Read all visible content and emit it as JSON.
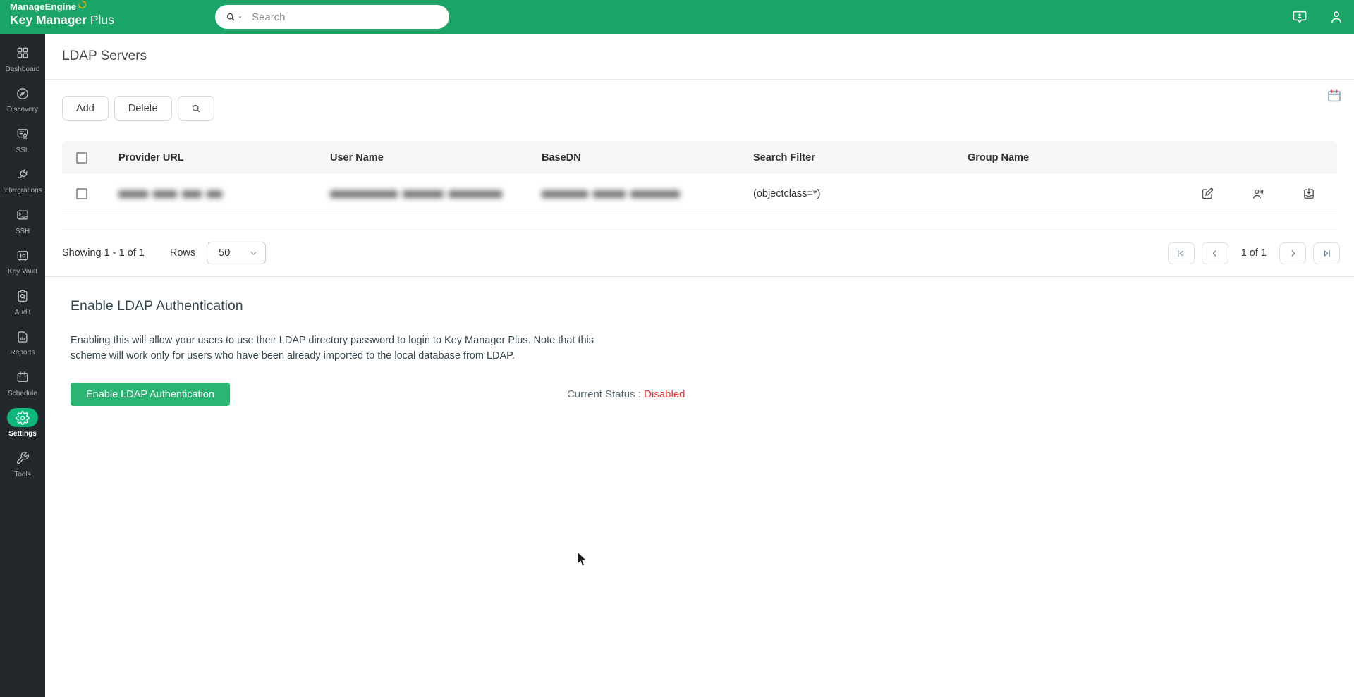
{
  "header": {
    "brand_line1": "ManageEngine",
    "brand_line2_bold": "Key Manager",
    "brand_line2_light": "Plus",
    "search_placeholder": "Search"
  },
  "sidebar": {
    "items": [
      {
        "label": "Dashboard",
        "icon": "grid",
        "active": false
      },
      {
        "label": "Discovery",
        "icon": "compass",
        "active": false
      },
      {
        "label": "SSL",
        "icon": "certificate",
        "active": false
      },
      {
        "label": "Intergrations",
        "icon": "plug",
        "active": false
      },
      {
        "label": "SSH",
        "icon": "terminal",
        "active": false
      },
      {
        "label": "Key Vault",
        "icon": "vault",
        "active": false
      },
      {
        "label": "Audit",
        "icon": "audit",
        "active": false
      },
      {
        "label": "Reports",
        "icon": "report",
        "active": false
      },
      {
        "label": "Schedule",
        "icon": "calendar",
        "active": false
      },
      {
        "label": "Settings",
        "icon": "gear",
        "active": true
      },
      {
        "label": "Tools",
        "icon": "tools",
        "active": false
      }
    ]
  },
  "page": {
    "title": "LDAP Servers"
  },
  "toolbar": {
    "add_label": "Add",
    "delete_label": "Delete"
  },
  "table": {
    "columns": [
      "Provider URL",
      "User Name",
      "BaseDN",
      "Search Filter",
      "Group Name"
    ],
    "rows": [
      {
        "provider_url": "",
        "user_name": "",
        "base_dn": "",
        "search_filter": "(objectclass=*)",
        "group_name": "",
        "redacted_fields": [
          "provider_url",
          "user_name",
          "base_dn"
        ],
        "actions": [
          "edit",
          "users",
          "import"
        ]
      }
    ]
  },
  "pagination": {
    "showing": "Showing 1 - 1 of 1",
    "rows_label": "Rows",
    "rows_per_page": "50",
    "page_indicator": "1 of 1"
  },
  "ldap_auth": {
    "heading": "Enable LDAP Authentication",
    "description": "Enabling this will allow your users to use their LDAP directory password to login to Key Manager Plus. Note that this scheme will work only for users who have been already imported to the local database from LDAP.",
    "button_label": "Enable LDAP Authentication",
    "status_label": "Current Status :",
    "status_value": "Disabled"
  },
  "colors": {
    "header_green": "#18a565",
    "active_green": "#0db77b",
    "button_green": "#2ab573",
    "sidebar_bg": "#22282b",
    "status_red": "#f23535"
  }
}
